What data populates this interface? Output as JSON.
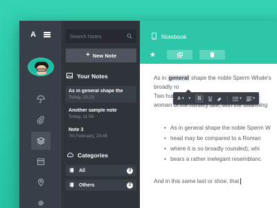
{
  "nav": {
    "logo": "A",
    "icons": [
      "umbrella-icon",
      "paperclip-icon",
      "layers-icon",
      "calendar-icon",
      "location-pin-icon",
      "gear-icon"
    ]
  },
  "search": {
    "placeholder": "Search Notes"
  },
  "new_note_label": "New Note",
  "your_notes": {
    "heading": "Your Notes",
    "items": [
      {
        "title": "As in general shape the",
        "date": "Today, 15:23"
      },
      {
        "title": "Another sample note",
        "date": "Today, 11:58"
      },
      {
        "title": "Note 3",
        "date": "7th February, 20:45"
      }
    ]
  },
  "categories": {
    "heading": "Categories",
    "items": [
      {
        "label": "All",
        "count": "3"
      },
      {
        "label": "Others",
        "count": "2"
      }
    ]
  },
  "editor": {
    "notebook_label": "Notebook",
    "line1_pre": "As in ",
    "line1_hl": "general",
    "line1_post": " shape the noble Sperm Whale's",
    "line2": "broadly ro",
    "line3": "Two hund",
    "line4": "woman of the nursery tale, with the swarming",
    "bullets": [
      "As in general shape the noble Sperm W",
      "head may be compared to a Roman",
      "where it is so broadly rounded); whi",
      "bears a rather inelegant resemblanc"
    ],
    "last_line": "And in this same last or shoe, that"
  },
  "toolbar": {
    "font": "A",
    "bold": "B",
    "underline": "U"
  },
  "colors": {
    "accent": "#2ec6a8",
    "rail": "#393f48",
    "list": "#2f343b"
  }
}
